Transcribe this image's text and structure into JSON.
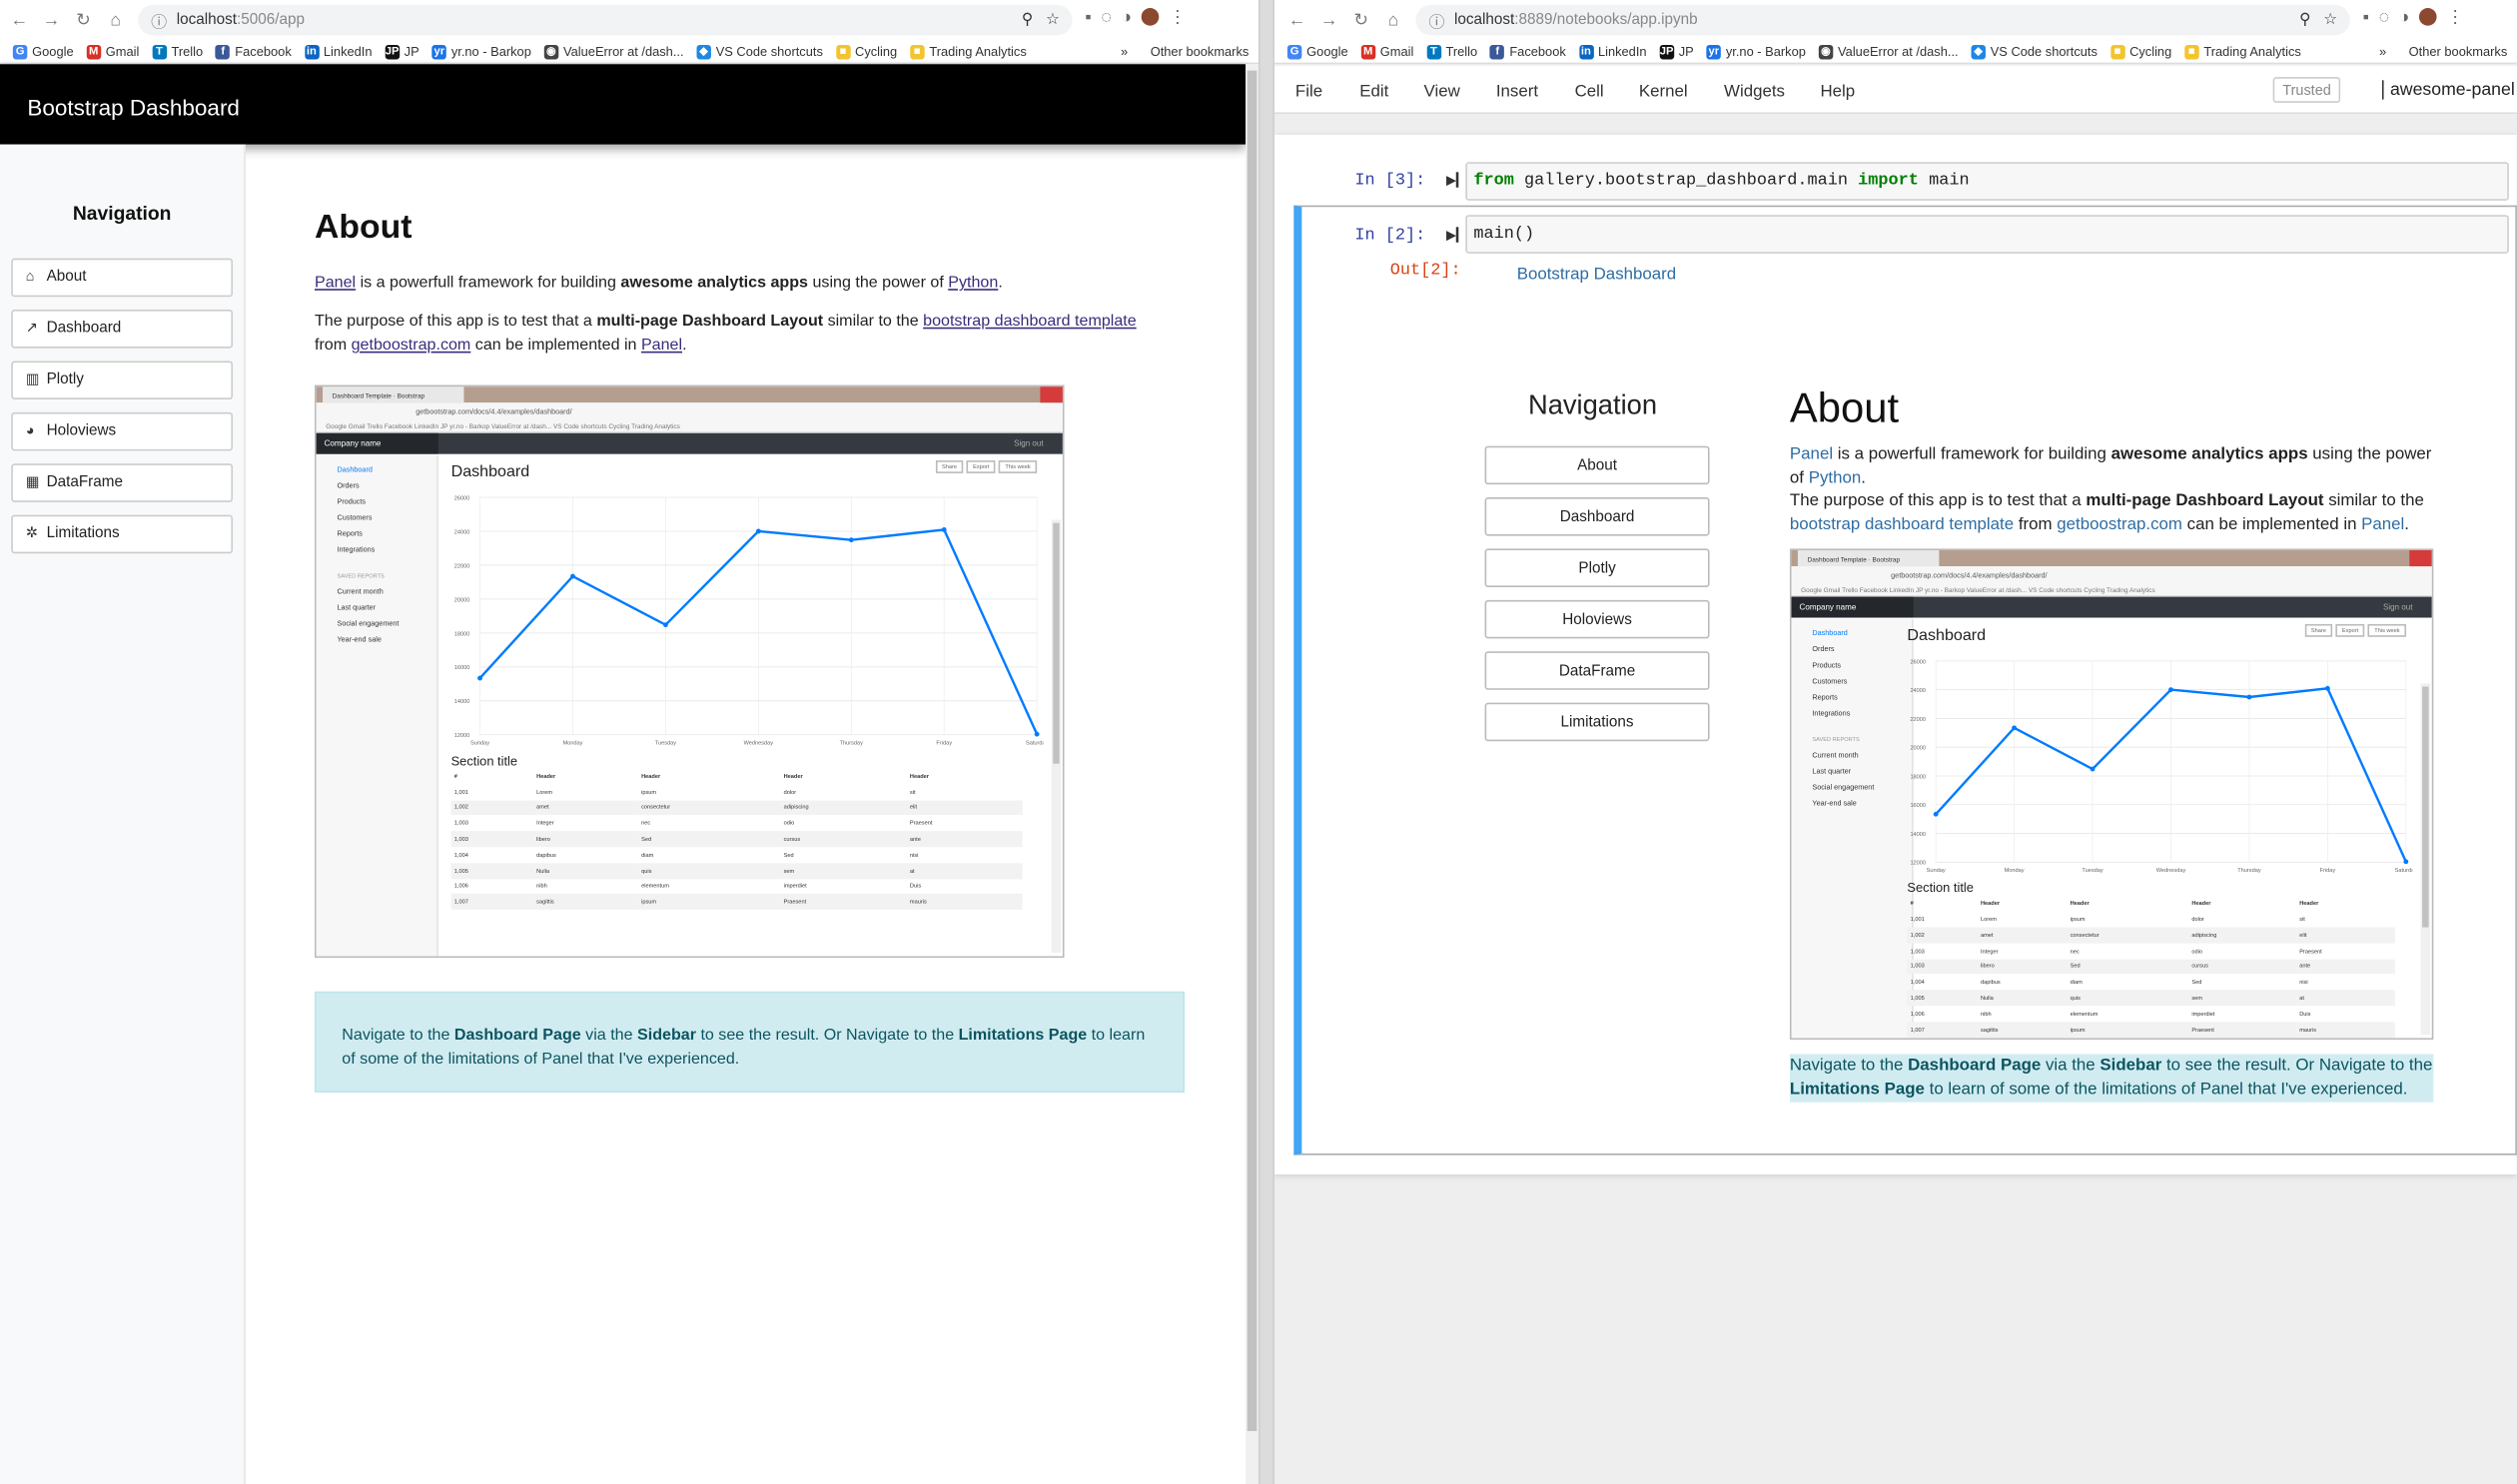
{
  "left_browser": {
    "url_host": "localhost",
    "url_path": ":5006/app",
    "bookmarks": [
      {
        "label": "Google",
        "icon": "G",
        "color": "#4285f4"
      },
      {
        "label": "Gmail",
        "icon": "M",
        "color": "#d93025"
      },
      {
        "label": "Trello",
        "icon": "T",
        "color": "#0079bf"
      },
      {
        "label": "Facebook",
        "icon": "f",
        "color": "#3b5998"
      },
      {
        "label": "LinkedIn",
        "icon": "in",
        "color": "#0a66c2"
      },
      {
        "label": "JP",
        "icon": "JP",
        "color": "#111111"
      },
      {
        "label": "yr.no - Barkop",
        "icon": "yr",
        "color": "#1a73e8"
      },
      {
        "label": "ValueError at /dash...",
        "icon": "◉",
        "color": "#444444"
      },
      {
        "label": "VS Code shortcuts",
        "icon": "◆",
        "color": "#1e88e5"
      },
      {
        "label": "Cycling",
        "icon": "■",
        "color": "#f4c430"
      },
      {
        "label": "Trading Analytics",
        "icon": "■",
        "color": "#f4c430"
      }
    ],
    "more": "»",
    "other_bookmarks": "Other bookmarks"
  },
  "right_browser": {
    "url_host": "localhost",
    "url_path": ":8889/notebooks/app.ipynb",
    "other_bookmarks": "Other bookmarks",
    "more": "»"
  },
  "app": {
    "header_title": "Bootstrap Dashboard",
    "sidebar_title": "Navigation",
    "nav": [
      {
        "label": "About",
        "icon": "⌂"
      },
      {
        "label": "Dashboard",
        "icon": "↗"
      },
      {
        "label": "Plotly",
        "icon": "▥"
      },
      {
        "label": "Holoviews",
        "icon": "◕"
      },
      {
        "label": "DataFrame",
        "icon": "▦"
      },
      {
        "label": "Limitations",
        "icon": "✲"
      }
    ],
    "about_title": "About",
    "p1": {
      "link1": "Panel",
      "t1": " is a powerfull framework for building ",
      "bold": "awesome analytics apps",
      "t2": " using the power of ",
      "link2": "Python",
      "t3": "."
    },
    "p2": {
      "t1": "The purpose of this app is to test that a ",
      "bold": "multi-page Dashboard Layout",
      "t2": " similar to the ",
      "link1": "bootstrap dashboard template",
      "t3": " from ",
      "link2": "getboostrap.com",
      "t4": " can be implemented in ",
      "link3": "Panel",
      "t5": "."
    },
    "callout": {
      "t1": "Navigate to the ",
      "b1": "Dashboard Page",
      "t2": " via the ",
      "b2": "Sidebar",
      "t3": " to see the result. Or Navigate to the ",
      "b3": "Limitations Page",
      "t4": " to learn of some of the limitations of Panel that I've experienced."
    }
  },
  "screenshot": {
    "tab_title": "Dashboard Template · Bootstrap",
    "url": "getbootstrap.com/docs/4.4/examples/dashboard/",
    "bookmarks_line": "Google  Gmail  Trello  Facebook  LinkedIn  JP  yr.no - Barkop  ValueError at /dash...  VS Code shortcuts  Cycling  Trading Analytics",
    "company": "Company name",
    "signout": "Sign out",
    "side_items": [
      "Dashboard",
      "Orders",
      "Products",
      "Customers",
      "Reports",
      "Integrations"
    ],
    "saved_header": "SAVED REPORTS",
    "saved_items": [
      "Current month",
      "Last quarter",
      "Social engagement",
      "Year-end sale"
    ],
    "dashboard_title": "Dashboard",
    "buttons": [
      "Share",
      "Export",
      "This week"
    ],
    "section_title": "Section title",
    "table_headers": [
      "#",
      "Header",
      "Header",
      "Header",
      "Header"
    ],
    "table_rows": [
      [
        "1,001",
        "Lorem",
        "ipsum",
        "dolor",
        "sit"
      ],
      [
        "1,002",
        "amet",
        "consectetur",
        "adipiscing",
        "elit"
      ],
      [
        "1,003",
        "Integer",
        "nec",
        "odio",
        "Praesent"
      ],
      [
        "1,003",
        "libero",
        "Sed",
        "cursus",
        "ante"
      ],
      [
        "1,004",
        "dapibus",
        "diam",
        "Sed",
        "nisi"
      ],
      [
        "1,005",
        "Nulla",
        "quis",
        "sem",
        "at"
      ],
      [
        "1,006",
        "nibh",
        "elementum",
        "imperdiet",
        "Duis"
      ],
      [
        "1,007",
        "sagittis",
        "ipsum",
        "Praesent",
        "mauris"
      ]
    ]
  },
  "chart_data": {
    "type": "line",
    "categories": [
      "Sunday",
      "Monday",
      "Tuesday",
      "Wednesday",
      "Thursday",
      "Friday",
      "Saturday"
    ],
    "values": [
      15339,
      21345,
      18483,
      24003,
      23489,
      24092,
      12034
    ],
    "yticks": [
      12000,
      14000,
      16000,
      18000,
      20000,
      22000,
      24000,
      26000
    ],
    "ylim": [
      12000,
      26000
    ],
    "color": "#007bff",
    "grid": true
  },
  "jupyter": {
    "menu": [
      "File",
      "Edit",
      "View",
      "Insert",
      "Cell",
      "Kernel",
      "Widgets",
      "Help"
    ],
    "trusted": "Trusted",
    "kernel": "awesome-panel",
    "cell1_prompt": "In [3]:",
    "cell1_code": {
      "kw1": "from",
      "mod": " gallery.bootstrap_dashboard.main ",
      "kw2": "import",
      "name": " main"
    },
    "cell2_prompt": "In [2]:",
    "cell2_code": "main()",
    "out_prompt": "Out[2]:",
    "out_title": "Bootstrap Dashboard"
  }
}
